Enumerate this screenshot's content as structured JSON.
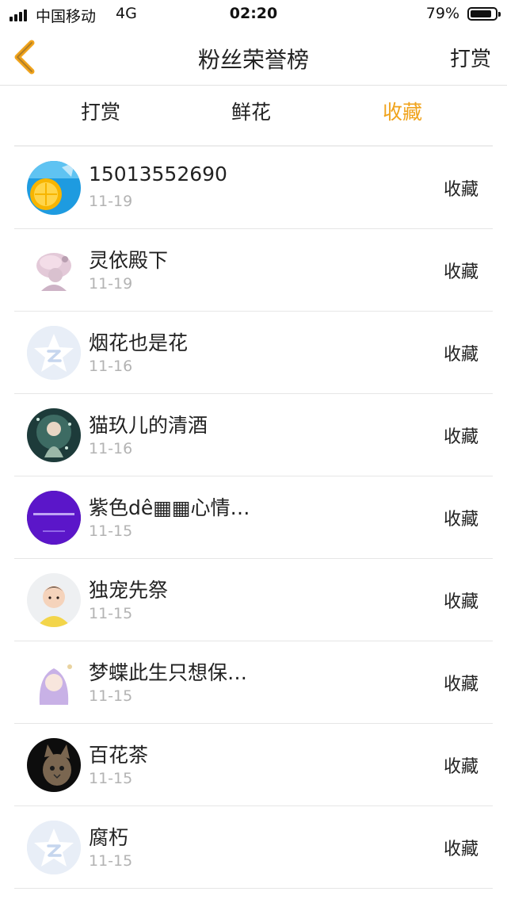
{
  "status_bar": {
    "carrier": "中国移动",
    "network": "4G",
    "time": "02:20",
    "battery": "79%",
    "battery_level": 0.79
  },
  "nav": {
    "title": "粉丝荣誉榜",
    "action_label": "打赏",
    "back_icon": "chevron-left-icon"
  },
  "tabs": [
    {
      "label": "打赏",
      "active": false
    },
    {
      "label": "鲜花",
      "active": false
    },
    {
      "label": "收藏",
      "active": true
    }
  ],
  "colors": {
    "accent": "#f0a31c",
    "date_gray": "#b3b3b3",
    "divider": "#e6e6e6"
  },
  "fans": [
    {
      "name": "15013552690",
      "date": "11-19",
      "action": "收藏",
      "avatar": "lemon-photo"
    },
    {
      "name": "灵依殿下",
      "date": "11-19",
      "action": "收藏",
      "avatar": "illustration-girl"
    },
    {
      "name": "烟花也是花",
      "date": "11-16",
      "action": "收藏",
      "avatar": "default-qq-icon"
    },
    {
      "name": "猫玖儿的清酒",
      "date": "11-16",
      "action": "收藏",
      "avatar": "anime-girl-green"
    },
    {
      "name": "紫色dê▦▦心情…",
      "date": "11-15",
      "action": "收藏",
      "avatar": "purple-text-circle"
    },
    {
      "name": "独宠先祭",
      "date": "11-15",
      "action": "收藏",
      "avatar": "child-photo"
    },
    {
      "name": "梦蝶此生只想保…",
      "date": "11-15",
      "action": "收藏",
      "avatar": "purple-hair-girl"
    },
    {
      "name": "百花茶",
      "date": "11-15",
      "action": "收藏",
      "avatar": "cat-photo"
    },
    {
      "name": "腐朽",
      "date": "11-15",
      "action": "收藏",
      "avatar": "default-qq-icon"
    }
  ]
}
